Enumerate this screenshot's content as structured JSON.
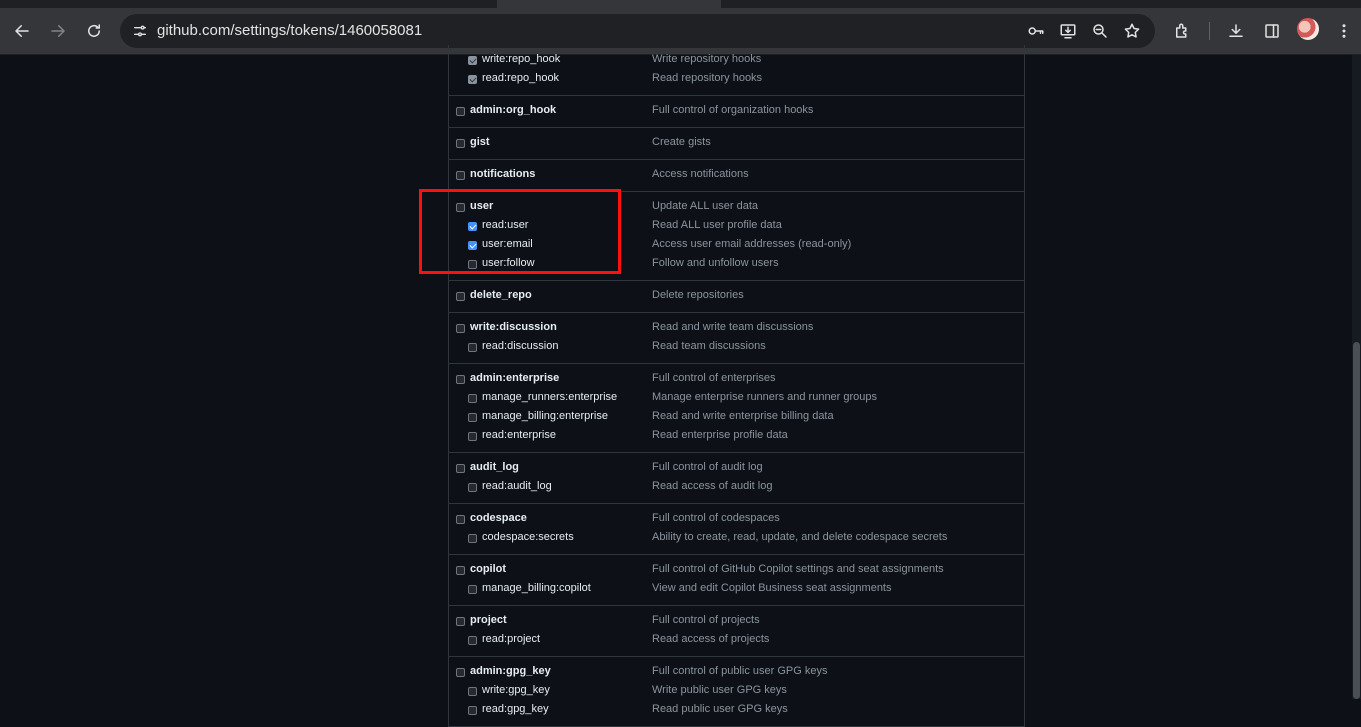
{
  "browser": {
    "url": "github.com/settings/tokens/1460058081"
  },
  "scopes": [
    {
      "parent": null,
      "children": [
        {
          "name": "write:repo_hook",
          "desc": "Write repository hooks",
          "checked": "dimmed"
        },
        {
          "name": "read:repo_hook",
          "desc": "Read repository hooks",
          "checked": "dimmed"
        }
      ]
    },
    {
      "parent": {
        "name": "admin:org_hook",
        "desc": "Full control of organization hooks",
        "checked": false
      },
      "children": []
    },
    {
      "parent": {
        "name": "gist",
        "desc": "Create gists",
        "checked": false
      },
      "children": []
    },
    {
      "parent": {
        "name": "notifications",
        "desc": "Access notifications",
        "checked": false
      },
      "children": []
    },
    {
      "parent": {
        "name": "user",
        "desc": "Update ALL user data",
        "checked": false
      },
      "children": [
        {
          "name": "read:user",
          "desc": "Read ALL user profile data",
          "checked": true
        },
        {
          "name": "user:email",
          "desc": "Access user email addresses (read-only)",
          "checked": true
        },
        {
          "name": "user:follow",
          "desc": "Follow and unfollow users",
          "checked": false
        }
      ]
    },
    {
      "parent": {
        "name": "delete_repo",
        "desc": "Delete repositories",
        "checked": false
      },
      "children": []
    },
    {
      "parent": {
        "name": "write:discussion",
        "desc": "Read and write team discussions",
        "checked": false
      },
      "children": [
        {
          "name": "read:discussion",
          "desc": "Read team discussions",
          "checked": false
        }
      ]
    },
    {
      "parent": {
        "name": "admin:enterprise",
        "desc": "Full control of enterprises",
        "checked": false
      },
      "children": [
        {
          "name": "manage_runners:enterprise",
          "desc": "Manage enterprise runners and runner groups",
          "checked": false
        },
        {
          "name": "manage_billing:enterprise",
          "desc": "Read and write enterprise billing data",
          "checked": false
        },
        {
          "name": "read:enterprise",
          "desc": "Read enterprise profile data",
          "checked": false
        }
      ]
    },
    {
      "parent": {
        "name": "audit_log",
        "desc": "Full control of audit log",
        "checked": false
      },
      "children": [
        {
          "name": "read:audit_log",
          "desc": "Read access of audit log",
          "checked": false
        }
      ]
    },
    {
      "parent": {
        "name": "codespace",
        "desc": "Full control of codespaces",
        "checked": false
      },
      "children": [
        {
          "name": "codespace:secrets",
          "desc": "Ability to create, read, update, and delete codespace secrets",
          "checked": false
        }
      ]
    },
    {
      "parent": {
        "name": "copilot",
        "desc": "Full control of GitHub Copilot settings and seat assignments",
        "checked": false
      },
      "children": [
        {
          "name": "manage_billing:copilot",
          "desc": "View and edit Copilot Business seat assignments",
          "checked": false
        }
      ]
    },
    {
      "parent": {
        "name": "project",
        "desc": "Full control of projects",
        "checked": false
      },
      "children": [
        {
          "name": "read:project",
          "desc": "Read access of projects",
          "checked": false
        }
      ]
    },
    {
      "parent": {
        "name": "admin:gpg_key",
        "desc": "Full control of public user GPG keys",
        "checked": false
      },
      "children": [
        {
          "name": "write:gpg_key",
          "desc": "Write public user GPG keys",
          "checked": false
        },
        {
          "name": "read:gpg_key",
          "desc": "Read public user GPG keys",
          "checked": false
        }
      ]
    }
  ],
  "colors": {
    "highlight": "#ff1010",
    "checkbox_checked": "#4493f8"
  }
}
